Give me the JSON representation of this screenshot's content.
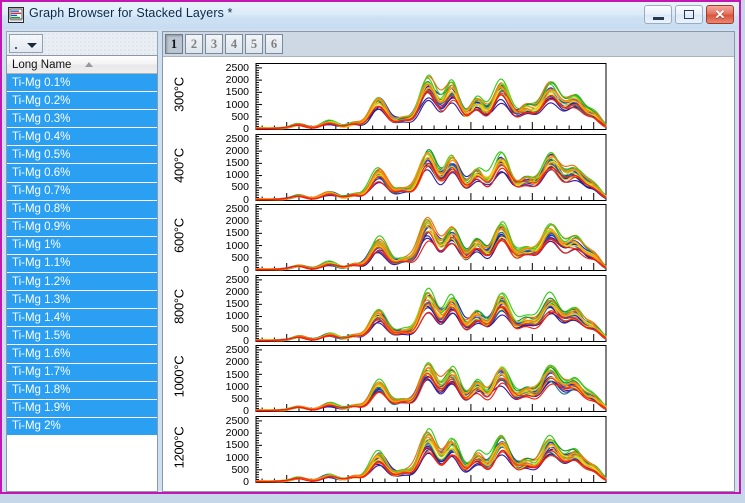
{
  "window": {
    "title": "Graph Browser for Stacked Layers *",
    "icon": "graph-window-icon",
    "buttons": {
      "minimize": "minimize-icon",
      "maximize": "maximize-icon",
      "close": "✕"
    },
    "frame_color": "#c317b5"
  },
  "sidebar": {
    "combo": {
      "label": "",
      "caret": "chevron-down-icon"
    },
    "list": {
      "header": "Long Name",
      "sort": "ascending",
      "rows": [
        "Ti-Mg 0.1%",
        "Ti-Mg 0.2%",
        "Ti-Mg 0.3%",
        "Ti-Mg 0.4%",
        "Ti-Mg 0.5%",
        "Ti-Mg 0.6%",
        "Ti-Mg 0.7%",
        "Ti-Mg 0.8%",
        "Ti-Mg 0.9%",
        "Ti-Mg 1%",
        "Ti-Mg 1.1%",
        "Ti-Mg 1.2%",
        "Ti-Mg 1.3%",
        "Ti-Mg 1.4%",
        "Ti-Mg 1.5%",
        "Ti-Mg 1.6%",
        "Ti-Mg 1.7%",
        "Ti-Mg 1.8%",
        "Ti-Mg 1.9%",
        "Ti-Mg 2%"
      ],
      "selection_color": "#2ba0f2"
    }
  },
  "tabs": {
    "items": [
      "1",
      "2",
      "3",
      "4",
      "5",
      "6"
    ],
    "active": "1"
  },
  "chart_data": {
    "type": "line",
    "title": "",
    "xlabel": "",
    "ylabel": "",
    "xlim": [
      15,
      72
    ],
    "xticks": [
      20,
      40,
      60
    ],
    "ylim": [
      0,
      2700
    ],
    "yticks": [
      0,
      500,
      1000,
      1500,
      2000,
      2500
    ],
    "grid": false,
    "legend_position": "right",
    "panels": [
      {
        "label": "300°C"
      },
      {
        "label": "400°C"
      },
      {
        "label": "600°C"
      },
      {
        "label": "800°C"
      },
      {
        "label": "1000°C"
      },
      {
        "label": "1200°C"
      }
    ],
    "peak_positions": [
      22,
      27,
      31,
      35,
      39,
      43,
      47,
      51,
      55,
      59,
      63,
      67,
      70
    ],
    "series": [
      {
        "name": "Ti-Mg 0.2%",
        "color": "#2e1d9c",
        "peak_scale": 0.62
      },
      {
        "name": "Ti-Mg 0.5%",
        "color": "#1b1fc8",
        "peak_scale": 0.8
      },
      {
        "name": "Ti-Mg 1.1%",
        "color": "#36cc1e",
        "peak_scale": 1.0
      },
      {
        "name": "Ti-Mg 1.8%",
        "color": "#f96a10",
        "peak_scale": 0.9
      },
      {
        "name": "Ti-Mg 0.1%",
        "color": "#3a1d9e",
        "peak_scale": 0.36
      },
      {
        "name": "Ti-Mg 0.3%",
        "color": "#27219b",
        "peak_scale": 0.44
      },
      {
        "name": "Ti-Mg 0.4%",
        "color": "#1d2487",
        "peak_scale": 0.52
      },
      {
        "name": "Ti-Mg 0.6%",
        "color": "#2336c6",
        "peak_scale": 0.68
      },
      {
        "name": "Ti-Mg 0.7%",
        "color": "#1c3fe2",
        "peak_scale": 0.72
      },
      {
        "name": "Ti-Mg 0.8%",
        "color": "#2354c9",
        "peak_scale": 0.66
      },
      {
        "name": "Ti-Mg 0.9%",
        "color": "#1c7a8c",
        "peak_scale": 0.58
      },
      {
        "name": "Ti-Mg 1%",
        "color": "#18922e",
        "peak_scale": 0.86
      },
      {
        "name": "Ti-Mg 1.2%",
        "color": "#4cc71c",
        "peak_scale": 0.92
      },
      {
        "name": "Ti-Mg 1.3%",
        "color": "#9bdc1c",
        "peak_scale": 0.78
      },
      {
        "name": "Ti-Mg 1.4%",
        "color": "#e8e420",
        "peak_scale": 0.6
      },
      {
        "name": "Ti-Mg 1.5%",
        "color": "#f3c31a",
        "peak_scale": 0.64
      },
      {
        "name": "Ti-Mg 1.6%",
        "color": "#f99f12",
        "peak_scale": 0.74
      },
      {
        "name": "Ti-Mg 1.7%",
        "color": "#f97f10",
        "peak_scale": 0.82
      },
      {
        "name": "Ti-Mg 1.9%",
        "color": "#f2360f",
        "peak_scale": 0.5
      },
      {
        "name": "Ti-Mg 2%",
        "color": "#f41b12",
        "peak_scale": 0.42
      }
    ]
  }
}
